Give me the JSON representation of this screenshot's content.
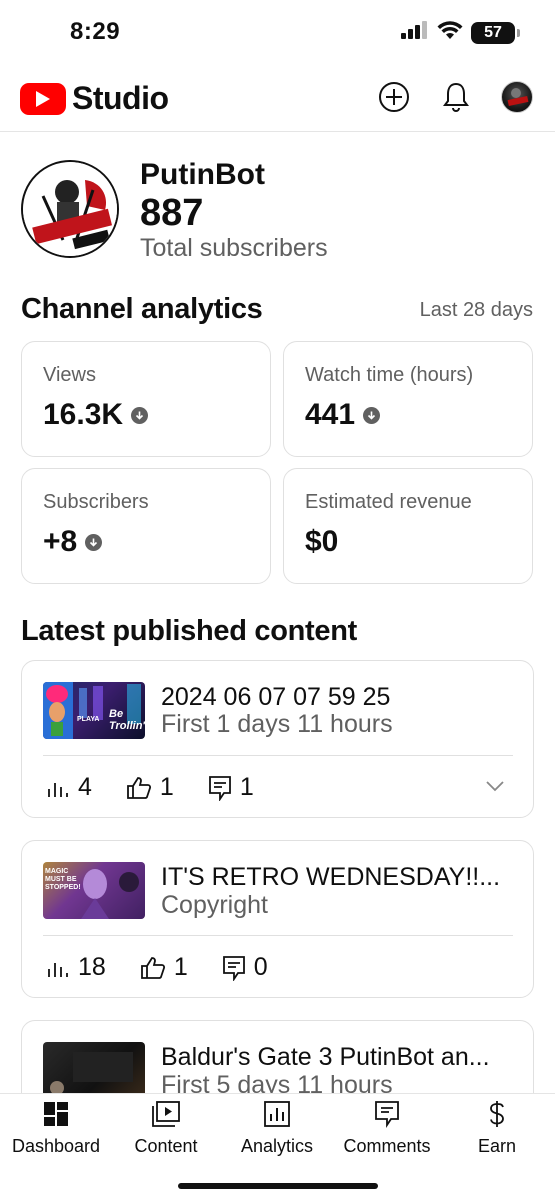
{
  "status": {
    "time": "8:29",
    "battery": "57"
  },
  "header": {
    "app_name": "Studio"
  },
  "channel": {
    "name": "PutinBot",
    "subscribers": "887",
    "subscribers_label": "Total subscribers",
    "avatar_text_1": "PUTINBOT",
    "avatar_text_2": "GAMING"
  },
  "analytics": {
    "title": "Channel analytics",
    "period": "Last 28 days",
    "metrics": [
      {
        "label": "Views",
        "value": "16.3K",
        "trend": "down"
      },
      {
        "label": "Watch time (hours)",
        "value": "441",
        "trend": "down"
      },
      {
        "label": "Subscribers",
        "value": "+8",
        "trend": "down"
      },
      {
        "label": "Estimated revenue",
        "value": "$0",
        "trend": "none"
      }
    ]
  },
  "latest": {
    "title": "Latest published content",
    "items": [
      {
        "title": "2024 06 07 07 59 25",
        "subtitle": "First 1 days 11 hours",
        "views": "4",
        "likes": "1",
        "comments": "1",
        "thumb_text": "Be Trollin'",
        "thumb_brand": "PLAYA"
      },
      {
        "title": "IT'S RETRO WEDNESDAY!!...",
        "subtitle": "Copyright",
        "views": "18",
        "likes": "1",
        "comments": "0",
        "thumb_text": "MAGIC MUST BE STOPPED!"
      },
      {
        "title": "Baldur's Gate 3 PutinBot an...",
        "subtitle": "First 5 days 11 hours"
      }
    ]
  },
  "nav": {
    "items": [
      {
        "label": "Dashboard",
        "icon": "dashboard-icon"
      },
      {
        "label": "Content",
        "icon": "content-icon"
      },
      {
        "label": "Analytics",
        "icon": "analytics-icon"
      },
      {
        "label": "Comments",
        "icon": "comments-icon"
      },
      {
        "label": "Earn",
        "icon": "earn-icon"
      }
    ]
  },
  "colors": {
    "brand": "#ff0000",
    "text": "#0f0f0f",
    "secondary": "#606060",
    "border": "#e0e0e0"
  }
}
